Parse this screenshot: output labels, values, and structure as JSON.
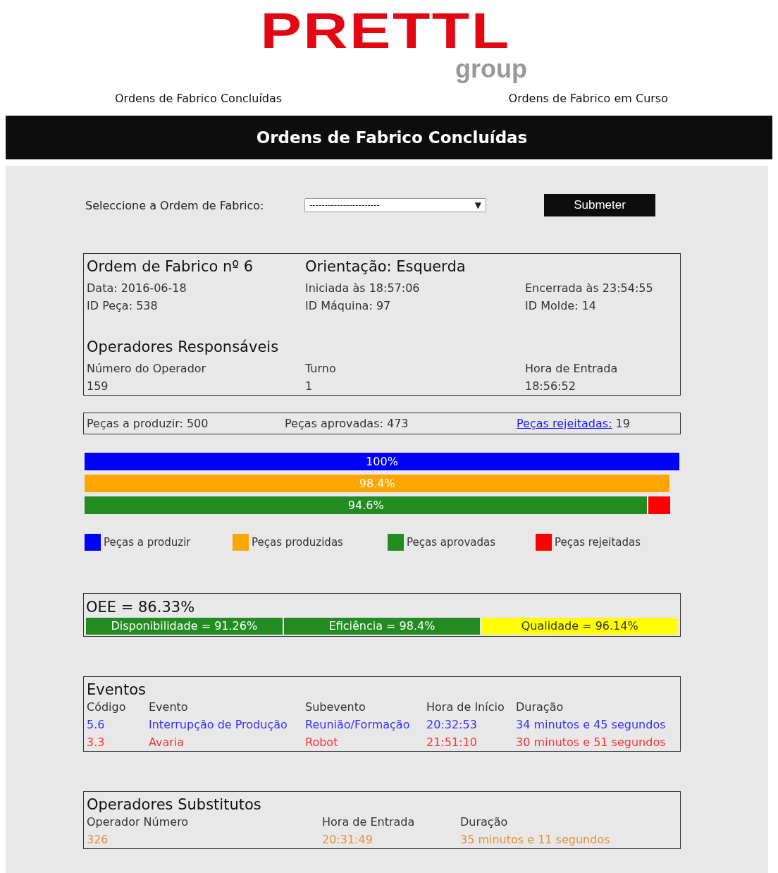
{
  "logo": {
    "brand": "PRETTL",
    "tagline": "group"
  },
  "nav": [
    "Ordens de Fabrico Concluídas",
    "Ordens de Fabrico em Curso"
  ],
  "banner": {
    "title": "Ordens de Fabrico Concluídas"
  },
  "selector": {
    "label": "Seleccione a Ordem de Fabrico:",
    "value": "-----------------------",
    "caret": "▼",
    "button": "Submeter"
  },
  "order": {
    "title": "Ordem de Fabrico nº 6",
    "orientation": "Orientação: Esquerda",
    "details": [
      [
        "Data: 2016-06-18",
        "Iniciada às 18:57:06",
        "Encerrada às 23:54:55"
      ],
      [
        "ID Peça: 538",
        "ID Máquina: 97",
        "ID Molde: 14"
      ]
    ],
    "operators_title": "Operadores Responsáveis",
    "operators_columns": [
      "Número do Operador",
      "Turno",
      "Hora de Entrada"
    ],
    "operators_rows": [
      [
        "159",
        "1",
        "18:56:52"
      ]
    ]
  },
  "counts": {
    "to_produce": "Peças a produzir: 500",
    "approved": "Peças aprovadas: 473",
    "rejected_link": "Peças rejeitadas:",
    "rejected_value": "19"
  },
  "bars": [
    {
      "segments": [
        {
          "label": "100%",
          "color": "#0000ff"
        }
      ]
    },
    {
      "segments": [
        {
          "label": "98.4%",
          "color": "#ffa500"
        }
      ]
    },
    {
      "segments": [
        {
          "label": "94.6%",
          "color": "#228b22"
        },
        {
          "color": "#ff0000"
        }
      ]
    }
  ],
  "legend": [
    {
      "label": "Peças a produzir",
      "color": "#0000ff"
    },
    {
      "label": "Peças produzidas",
      "color": "#ffa500"
    },
    {
      "label": "Peças aprovadas",
      "color": "#228b22"
    },
    {
      "label": "Peças rejeitadas",
      "color": "#ff0000"
    }
  ],
  "oee": {
    "title": "OEE = 86.33%",
    "parts": [
      {
        "label": "Disponibilidade = 91.26%",
        "color": "#228b22"
      },
      {
        "label": "Eficiência = 98.4%",
        "color": "#228b22"
      },
      {
        "label": "Qualidade = 96.14%",
        "color": "#ffff00"
      }
    ]
  },
  "events": {
    "title": "Eventos",
    "columns": [
      "Código",
      "Evento",
      "Subevento",
      "Hora de Início",
      "Duração"
    ],
    "rows": [
      {
        "cells": [
          "5.6",
          "Interrupção de Produção",
          "Reunião/Formação",
          "20:32:53",
          "34 minutos e 45 segundos"
        ],
        "color": "#3333ff"
      },
      {
        "cells": [
          "3.3",
          "Avaria",
          "Robot",
          "21:51:10",
          "30 minutos e 51 segundos"
        ],
        "color": "#ff3333"
      }
    ]
  },
  "substitutes": {
    "title": "Operadores Substitutos",
    "columns": [
      "Operador Número",
      "Hora de Entrada",
      "Duração"
    ],
    "rows": [
      {
        "cells": [
          "326",
          "20:31:49",
          "35 minutos e 11 segundos"
        ],
        "color": "#e8903a"
      }
    ]
  }
}
